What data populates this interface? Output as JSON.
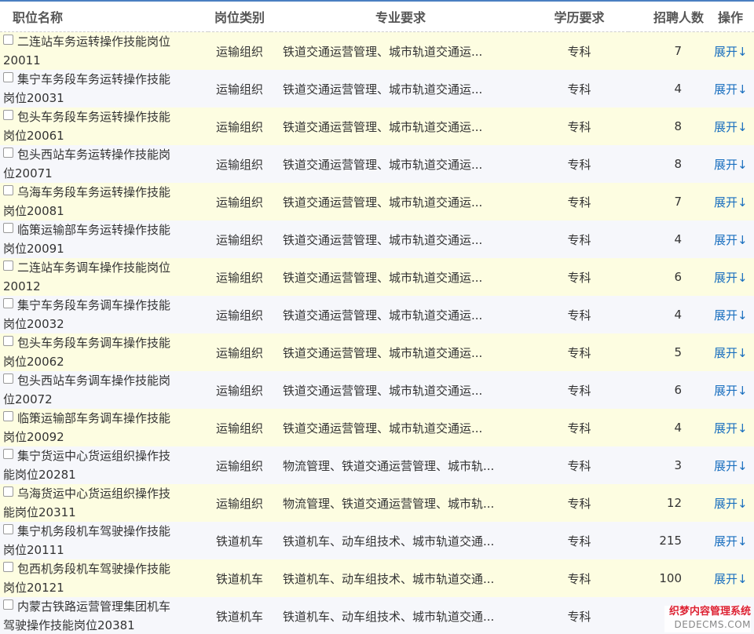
{
  "headers": {
    "name": "职位名称",
    "type": "岗位类别",
    "major": "专业要求",
    "edu": "学历要求",
    "num": "招聘人数",
    "op": "操作"
  },
  "rows": [
    {
      "name": [
        "二连站车务运转操作技能岗位",
        "20011"
      ],
      "type": "运输组织",
      "major": "铁道交通运营管理、城市轨道交通运...",
      "edu": "专科",
      "num": "7",
      "op": "展开↓"
    },
    {
      "name": [
        "集宁车务段车务运转操作技能",
        "岗位20031"
      ],
      "type": "运输组织",
      "major": "铁道交通运营管理、城市轨道交通运...",
      "edu": "专科",
      "num": "4",
      "op": "展开↓"
    },
    {
      "name": [
        "包头车务段车务运转操作技能",
        "岗位20061"
      ],
      "type": "运输组织",
      "major": "铁道交通运营管理、城市轨道交通运...",
      "edu": "专科",
      "num": "8",
      "op": "展开↓"
    },
    {
      "name": [
        "包头西站车务运转操作技能岗",
        "位20071"
      ],
      "type": "运输组织",
      "major": "铁道交通运营管理、城市轨道交通运...",
      "edu": "专科",
      "num": "8",
      "op": "展开↓"
    },
    {
      "name": [
        "乌海车务段车务运转操作技能",
        "岗位20081"
      ],
      "type": "运输组织",
      "major": "铁道交通运营管理、城市轨道交通运...",
      "edu": "专科",
      "num": "7",
      "op": "展开↓"
    },
    {
      "name": [
        "临策运输部车务运转操作技能",
        "岗位20091"
      ],
      "type": "运输组织",
      "major": "铁道交通运营管理、城市轨道交通运...",
      "edu": "专科",
      "num": "4",
      "op": "展开↓"
    },
    {
      "name": [
        "二连站车务调车操作技能岗位",
        "20012"
      ],
      "type": "运输组织",
      "major": "铁道交通运营管理、城市轨道交通运...",
      "edu": "专科",
      "num": "6",
      "op": "展开↓"
    },
    {
      "name": [
        "集宁车务段车务调车操作技能",
        "岗位20032"
      ],
      "type": "运输组织",
      "major": "铁道交通运营管理、城市轨道交通运...",
      "edu": "专科",
      "num": "4",
      "op": "展开↓"
    },
    {
      "name": [
        "包头车务段车务调车操作技能",
        "岗位20062"
      ],
      "type": "运输组织",
      "major": "铁道交通运营管理、城市轨道交通运...",
      "edu": "专科",
      "num": "5",
      "op": "展开↓"
    },
    {
      "name": [
        "包头西站车务调车操作技能岗",
        "位20072"
      ],
      "type": "运输组织",
      "major": "铁道交通运营管理、城市轨道交通运...",
      "edu": "专科",
      "num": "6",
      "op": "展开↓"
    },
    {
      "name": [
        "临策运输部车务调车操作技能",
        "岗位20092"
      ],
      "type": "运输组织",
      "major": "铁道交通运营管理、城市轨道交通运...",
      "edu": "专科",
      "num": "4",
      "op": "展开↓"
    },
    {
      "name": [
        "集宁货运中心货运组织操作技",
        "能岗位20281"
      ],
      "type": "运输组织",
      "major": "物流管理、铁道交通运营管理、城市轨...",
      "edu": "专科",
      "num": "3",
      "op": "展开↓"
    },
    {
      "name": [
        "乌海货运中心货运组织操作技",
        "能岗位20311"
      ],
      "type": "运输组织",
      "major": "物流管理、铁道交通运营管理、城市轨...",
      "edu": "专科",
      "num": "12",
      "op": "展开↓"
    },
    {
      "name": [
        "集宁机务段机车驾驶操作技能",
        "岗位20111"
      ],
      "type": "铁道机车",
      "major": "铁道机车、动车组技术、城市轨道交通...",
      "edu": "专科",
      "num": "215",
      "op": "展开↓"
    },
    {
      "name": [
        "包西机务段机车驾驶操作技能",
        "岗位20121"
      ],
      "type": "铁道机车",
      "major": "铁道机车、动车组技术、城市轨道交通...",
      "edu": "专科",
      "num": "100",
      "op": "展开↓"
    },
    {
      "name": [
        "内蒙古铁路运营管理集团机车",
        "驾驶操作技能岗位20381"
      ],
      "type": "铁道机车",
      "major": "铁道机车、动车组技术、城市轨道交通...",
      "edu": "专科",
      "num": "",
      "op": ""
    }
  ],
  "watermark": {
    "line1": "织梦内容管理系统",
    "line2": "DEDECMS.COM"
  }
}
